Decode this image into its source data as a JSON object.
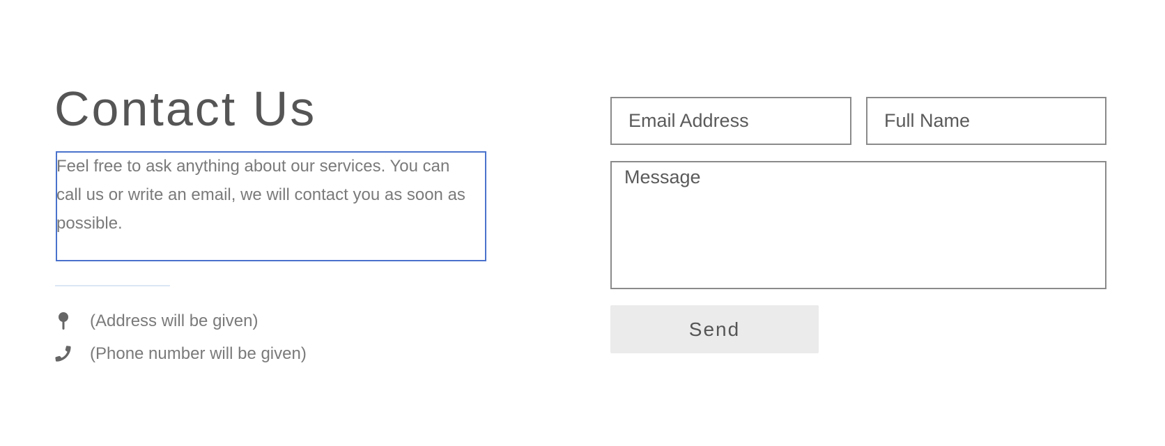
{
  "header": {
    "title": "Contact Us"
  },
  "intro": {
    "description": "Feel free to ask anything about our services. You can call us or write an email, we will contact you as soon as possible."
  },
  "contact_info": {
    "address": {
      "icon": "map-pin-icon",
      "text": "(Address will be given)"
    },
    "phone": {
      "icon": "phone-icon",
      "text": "(Phone number will be given)"
    }
  },
  "form": {
    "email_placeholder": "Email Address",
    "name_placeholder": "Full Name",
    "message_placeholder": "Message",
    "submit_label": "Send"
  },
  "colors": {
    "selection_outline": "#4a72cc",
    "divider": "#dbe6f5",
    "button_background": "#ebebeb",
    "text": "#555555"
  }
}
